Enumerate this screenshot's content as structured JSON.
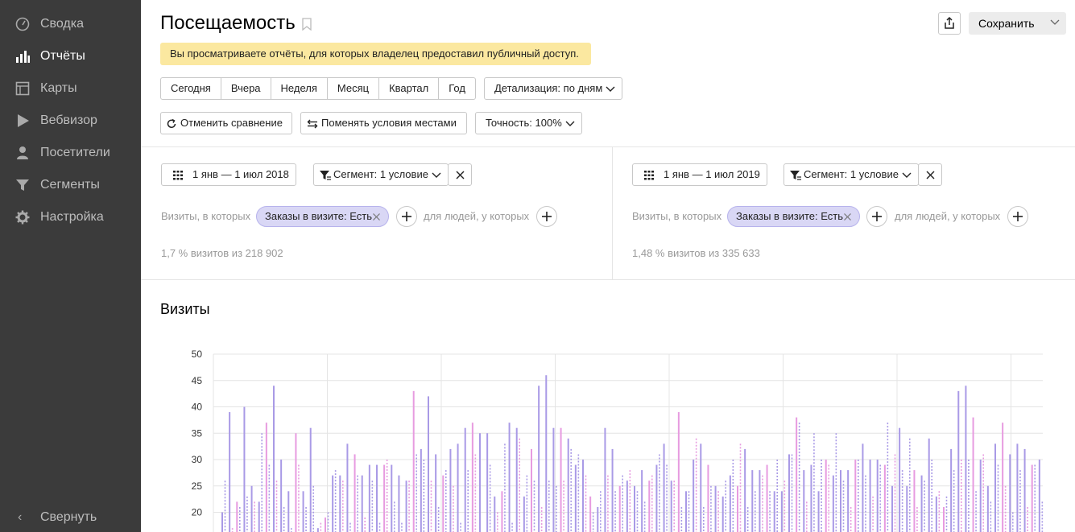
{
  "sidebar": {
    "items": [
      {
        "label": "Сводка",
        "icon": "gauge-icon",
        "active": false
      },
      {
        "label": "Отчёты",
        "icon": "bar-chart-icon",
        "active": true
      },
      {
        "label": "Карты",
        "icon": "map-icon",
        "active": false
      },
      {
        "label": "Вебвизор",
        "icon": "play-icon",
        "active": false
      },
      {
        "label": "Посетители",
        "icon": "person-icon",
        "active": false
      },
      {
        "label": "Сегменты",
        "icon": "funnel-icon",
        "active": false
      },
      {
        "label": "Настройка",
        "icon": "gear-icon",
        "active": false
      }
    ],
    "collapse_label": "Свернуть"
  },
  "header": {
    "title": "Посещаемость",
    "save_label": "Сохранить",
    "notice": "Вы просматриваете отчёты, для которых владелец предоставил публичный доступ."
  },
  "periods": [
    "Сегодня",
    "Вчера",
    "Неделя",
    "Месяц",
    "Квартал",
    "Год"
  ],
  "detail_label": "Детализация: по дням",
  "compare": {
    "cancel_label": "Отменить сравнение",
    "swap_label": "Поменять условия местами",
    "accuracy_label": "Точность: 100%"
  },
  "segments": [
    {
      "date_range": "1 янв — 1 июл 2018",
      "segment_label": "Сегмент: 1 условие",
      "visits_prefix": "Визиты, в которых",
      "chip_label": "Заказы в визите: Есть",
      "people_label": "для людей, у которых",
      "stat": "1,7 % визитов из 218 902"
    },
    {
      "date_range": "1 янв — 1 июл 2019",
      "segment_label": "Сегмент: 1 условие",
      "visits_prefix": "Визиты, в которых",
      "chip_label": "Заказы в визите: Есть",
      "people_label": "для людей, у которых",
      "stat": "1,48 % визитов из 335 633"
    }
  ],
  "colors": {
    "series_a": "#a99ae6",
    "series_b": "#e79be0",
    "grid": "#e4e4e4"
  },
  "chart_data": {
    "type": "bar",
    "title": "Визиты",
    "ylim": [
      20,
      50
    ],
    "yticks": [
      50,
      45,
      40,
      35,
      30,
      25,
      20
    ],
    "grid": true,
    "series": [
      {
        "style": "solid",
        "values": [
          20,
          39,
          22,
          40,
          25,
          22,
          37,
          44,
          30,
          24,
          35,
          24,
          36,
          17,
          19,
          27,
          27,
          33,
          31,
          27,
          29,
          29,
          29,
          29,
          27,
          26,
          43,
          32,
          42,
          31,
          27,
          32,
          33,
          36,
          37,
          35,
          35,
          23,
          24,
          37,
          36,
          23,
          32,
          44,
          46,
          36,
          36,
          34,
          29,
          30,
          23,
          21,
          36,
          32,
          25,
          26,
          25,
          28,
          26,
          29,
          33,
          26,
          39,
          24,
          30,
          33,
          29,
          25,
          23,
          27,
          25,
          32,
          28,
          28,
          29,
          24,
          24,
          31,
          38,
          28,
          29,
          24,
          30,
          27,
          28,
          28,
          30,
          33,
          30,
          30,
          29,
          25,
          36,
          25,
          28,
          27,
          34,
          23,
          21,
          32,
          43,
          44,
          38,
          30,
          25,
          33,
          37,
          31,
          33,
          32,
          29,
          30
        ]
      },
      {
        "style": "dashed",
        "values": [
          26,
          17,
          21,
          23,
          22,
          35,
          29,
          26,
          21,
          17,
          29,
          21,
          25,
          18,
          20,
          28,
          26,
          18,
          27,
          19,
          26,
          18,
          30,
          22,
          18,
          26,
          31,
          30,
          26,
          21,
          28,
          25,
          18,
          28,
          31,
          16,
          29,
          20,
          33,
          18,
          34,
          27,
          26,
          21,
          26,
          25,
          26,
          32,
          31,
          27,
          20,
          24,
          27,
          24,
          27,
          28,
          24,
          22,
          27,
          31,
          29,
          26,
          21,
          24,
          34,
          21,
          25,
          24,
          26,
          30,
          33,
          21,
          24,
          27,
          24,
          30,
          26,
          31,
          37,
          22,
          35,
          30,
          29,
          35,
          26,
          21,
          30,
          27,
          23,
          29,
          37,
          31,
          28,
          34,
          21,
          26,
          30,
          24,
          23,
          28,
          30,
          30,
          24,
          31,
          22,
          29,
          25,
          20,
          28,
          21,
          29,
          22
        ]
      }
    ]
  }
}
